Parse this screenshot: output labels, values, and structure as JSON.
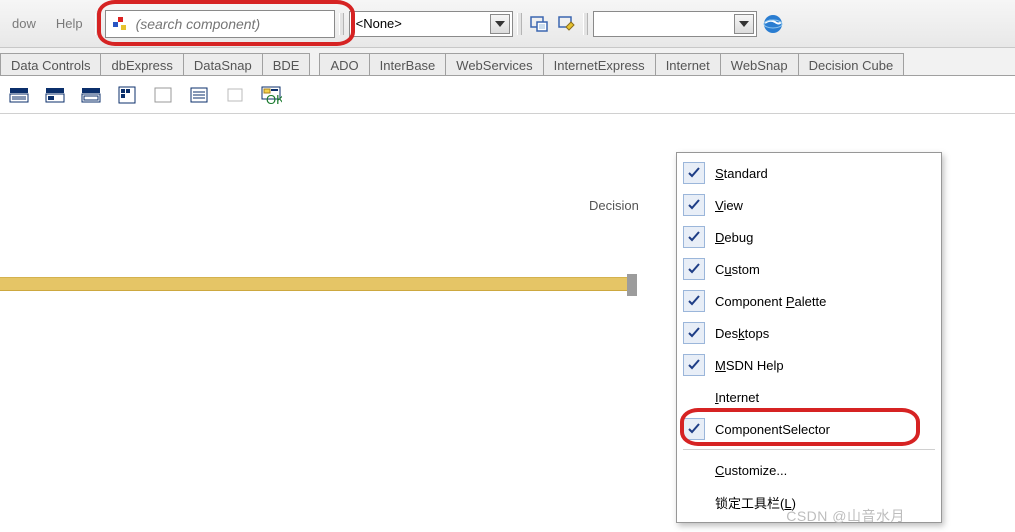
{
  "menu": {
    "item0": "dow",
    "item1": "Help"
  },
  "search": {
    "placeholder": "(search component)"
  },
  "combo_none": {
    "value": "<None>"
  },
  "tabs": {
    "t0": "Data Controls",
    "t1": "dbExpress",
    "t2": "DataSnap",
    "t3": "BDE",
    "t4": "ADO",
    "t5": "InterBase",
    "t6": "WebServices",
    "t7": "InternetExpress",
    "t8": "Internet",
    "t9": "WebSnap",
    "t10": "Decision Cube"
  },
  "ctx": {
    "standard": "Standard",
    "view": "View",
    "debug": "Debug",
    "custom": "Custom",
    "palette": "Component Palette",
    "desktops": "Desktops",
    "msdn": "MSDN Help",
    "internet": "Internet",
    "componentselector": "ComponentSelector",
    "customize": "Customize...",
    "lock": "锁定工具栏(L)"
  },
  "fragment": {
    "decision": "Decision"
  },
  "watermark": "CSDN @山音水月"
}
